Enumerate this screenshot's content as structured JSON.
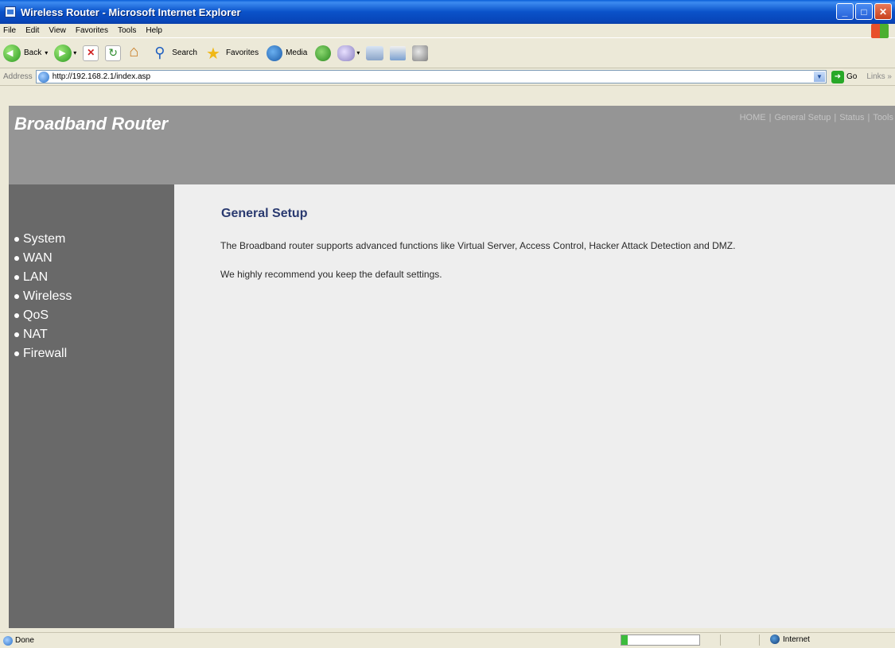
{
  "window": {
    "title": "Wireless Router - Microsoft Internet Explorer",
    "controls": [
      "_",
      "□",
      "✕"
    ]
  },
  "menu": [
    "File",
    "Edit",
    "View",
    "Favorites",
    "Tools",
    "Help"
  ],
  "toolbar": {
    "back_label": "Back",
    "search_label": "Search",
    "favorites_label": "Favorites",
    "media_label": "Media"
  },
  "address": {
    "label": "Address",
    "url": "http://192.168.2.1/index.asp",
    "go_label": "Go",
    "links_label": "Links »"
  },
  "header": {
    "brand": "Broadband Router",
    "nav": [
      "HOME",
      "General Setup",
      "Status",
      "Tools"
    ],
    "separator": "|"
  },
  "sidebar": {
    "items": [
      "System",
      "WAN",
      "LAN",
      "Wireless",
      "QoS",
      "NAT",
      "Firewall"
    ]
  },
  "content": {
    "title": "General Setup",
    "description": "The Broadband router supports advanced functions like Virtual Server, Access Control, Hacker Attack Detection and DMZ.",
    "recommendation": "We highly recommend you keep the default settings."
  },
  "status": {
    "text": "Done",
    "progress_fraction": 0.08,
    "zone": "Internet"
  },
  "colors": {
    "header_bg": "#959595",
    "sidebar_bg": "#696969",
    "content_bg": "#eeeeee",
    "title_color": "#2a3a70"
  }
}
